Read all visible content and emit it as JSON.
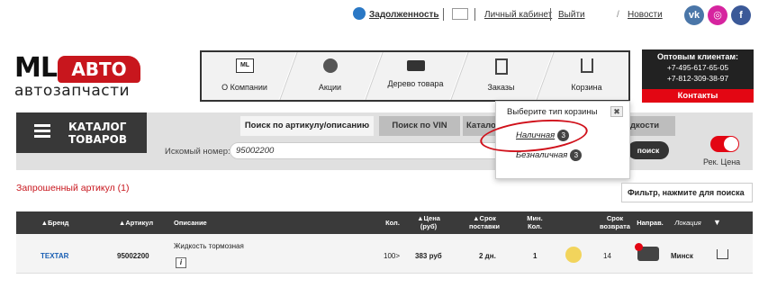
{
  "topbar": {
    "debt_label": "Задолженность",
    "cabinet_label": "Личный кабинет",
    "exit_label": "Выйти",
    "news_label": "Новости",
    "slash": "/",
    "social": [
      "vk-icon",
      "instagram-icon",
      "facebook-icon"
    ]
  },
  "logo": {
    "ml": "ML",
    "avto": "АВТО",
    "sub": "автозапчасти"
  },
  "nav": {
    "items": [
      {
        "label": "О Компании",
        "icon": "ml-icon"
      },
      {
        "label": "Акции",
        "icon": "sale-icon"
      },
      {
        "label": "Дерево товара",
        "icon": "truck-icon"
      },
      {
        "label": "Заказы",
        "icon": "clipboard-icon"
      },
      {
        "label": "Корзина",
        "icon": "cart-icon"
      }
    ]
  },
  "wholesale": {
    "title": "Оптовым клиентам:",
    "phone1": "+7-495-617-65-05",
    "phone2": "+7-812-309-38-97",
    "contacts": "Контакты"
  },
  "catalog": {
    "line1": "КАТАЛОГ",
    "line2": "ТОВАРОВ"
  },
  "tabs": [
    "Поиск по артикулу/описанию",
    "Поиск по VIN",
    "Катало",
    "дкости"
  ],
  "search": {
    "label": "Искомый номер:",
    "value": "95002200",
    "button": "поиск",
    "toggle_label": "Рек. Цена"
  },
  "popup": {
    "header": "Выберите тип корзины",
    "options": [
      {
        "label": "Наличная",
        "count": "3"
      },
      {
        "label": "Безналичная",
        "count": "3"
      }
    ]
  },
  "requested": "Запрошенный артикул (1)",
  "filter_placeholder": "Фильтр, нажмите для поиска",
  "table": {
    "headers": [
      "▲Бренд",
      "▲Артикул",
      "Описание",
      "Кол.",
      "▲Цена (руб)",
      "▲Срок поставки",
      "Мин. Кол.",
      "Срок возврата",
      "Направ.",
      "Локация"
    ],
    "row": {
      "brand": "TEXTAR",
      "article": "95002200",
      "description": "Жидкость тормозная",
      "qty": "100>",
      "price": "383 руб",
      "delivery": "2 дн.",
      "min_qty": "1",
      "return": "14",
      "location": "Минск"
    }
  },
  "colors": {
    "accent": "#e30613",
    "dark": "#383838",
    "link": "#1a5fb4"
  }
}
